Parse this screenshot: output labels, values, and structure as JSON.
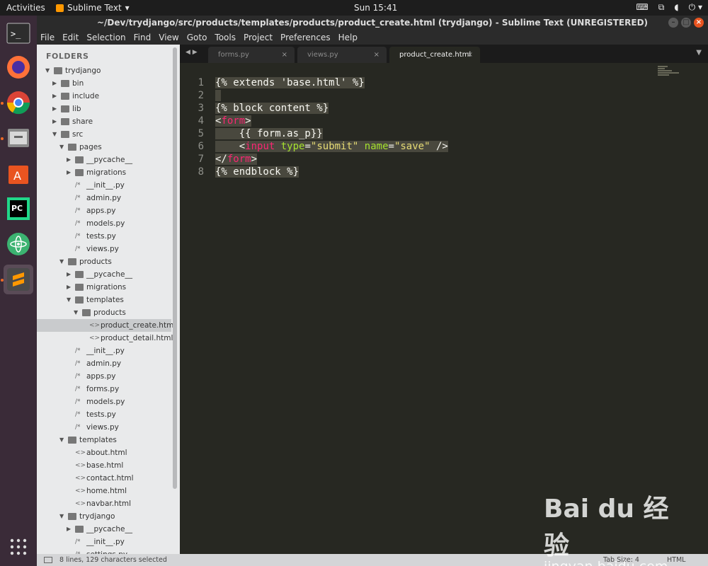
{
  "topbar": {
    "activities": "Activities",
    "app_menu": "Sublime Text",
    "clock": "Sun 15:41"
  },
  "window": {
    "title": "~/Dev/trydjango/src/products/templates/products/product_create.html (trydjango) - Sublime Text (UNREGISTERED)"
  },
  "menu": [
    "File",
    "Edit",
    "Selection",
    "Find",
    "View",
    "Goto",
    "Tools",
    "Project",
    "Preferences",
    "Help"
  ],
  "sidebar": {
    "header": "FOLDERS",
    "items": [
      {
        "label": "trydjango",
        "type": "folder",
        "depth": 0,
        "open": true
      },
      {
        "label": "bin",
        "type": "folder",
        "depth": 1,
        "open": false
      },
      {
        "label": "include",
        "type": "folder",
        "depth": 1,
        "open": false
      },
      {
        "label": "lib",
        "type": "folder",
        "depth": 1,
        "open": false
      },
      {
        "label": "share",
        "type": "folder",
        "depth": 1,
        "open": false
      },
      {
        "label": "src",
        "type": "folder",
        "depth": 1,
        "open": true
      },
      {
        "label": "pages",
        "type": "folder",
        "depth": 2,
        "open": true
      },
      {
        "label": "__pycache__",
        "type": "folder",
        "depth": 3,
        "open": false
      },
      {
        "label": "migrations",
        "type": "folder",
        "depth": 3,
        "open": false
      },
      {
        "label": "__init__.py",
        "type": "py",
        "depth": 3
      },
      {
        "label": "admin.py",
        "type": "py",
        "depth": 3
      },
      {
        "label": "apps.py",
        "type": "py",
        "depth": 3
      },
      {
        "label": "models.py",
        "type": "py",
        "depth": 3
      },
      {
        "label": "tests.py",
        "type": "py",
        "depth": 3
      },
      {
        "label": "views.py",
        "type": "py",
        "depth": 3
      },
      {
        "label": "products",
        "type": "folder",
        "depth": 2,
        "open": true
      },
      {
        "label": "__pycache__",
        "type": "folder",
        "depth": 3,
        "open": false
      },
      {
        "label": "migrations",
        "type": "folder",
        "depth": 3,
        "open": false
      },
      {
        "label": "templates",
        "type": "folder",
        "depth": 3,
        "open": true
      },
      {
        "label": "products",
        "type": "folder",
        "depth": 4,
        "open": true
      },
      {
        "label": "product_create.html",
        "type": "html",
        "depth": 5,
        "selected": true
      },
      {
        "label": "product_detail.html",
        "type": "html",
        "depth": 5
      },
      {
        "label": "__init__.py",
        "type": "py",
        "depth": 3
      },
      {
        "label": "admin.py",
        "type": "py",
        "depth": 3
      },
      {
        "label": "apps.py",
        "type": "py",
        "depth": 3
      },
      {
        "label": "forms.py",
        "type": "py",
        "depth": 3
      },
      {
        "label": "models.py",
        "type": "py",
        "depth": 3
      },
      {
        "label": "tests.py",
        "type": "py",
        "depth": 3
      },
      {
        "label": "views.py",
        "type": "py",
        "depth": 3
      },
      {
        "label": "templates",
        "type": "folder",
        "depth": 2,
        "open": true
      },
      {
        "label": "about.html",
        "type": "html",
        "depth": 3
      },
      {
        "label": "base.html",
        "type": "html",
        "depth": 3
      },
      {
        "label": "contact.html",
        "type": "html",
        "depth": 3
      },
      {
        "label": "home.html",
        "type": "html",
        "depth": 3
      },
      {
        "label": "navbar.html",
        "type": "html",
        "depth": 3
      },
      {
        "label": "trydjango",
        "type": "folder",
        "depth": 2,
        "open": true
      },
      {
        "label": "__pycache__",
        "type": "folder",
        "depth": 3,
        "open": false
      },
      {
        "label": "__init__.py",
        "type": "py",
        "depth": 3
      },
      {
        "label": "settings.py",
        "type": "py",
        "depth": 3
      }
    ]
  },
  "tabs": [
    {
      "label": "forms.py",
      "active": false
    },
    {
      "label": "views.py",
      "active": false
    },
    {
      "label": "product_create.html",
      "active": true
    }
  ],
  "editor": {
    "lines": [
      [
        {
          "t": "{% extends ",
          "c": "tpl"
        },
        {
          "t": "'base.html'",
          "c": "tpl"
        },
        {
          "t": " %}",
          "c": "tpl"
        }
      ],
      [],
      [
        {
          "t": "{% block content %}",
          "c": "tpl"
        }
      ],
      [
        {
          "t": "<",
          "c": "tpl"
        },
        {
          "t": "form",
          "c": "tag"
        },
        {
          "t": ">",
          "c": "tpl"
        }
      ],
      [
        {
          "t": "    {{ form.as_p}}",
          "c": "tpl"
        }
      ],
      [
        {
          "t": "    <",
          "c": "tpl"
        },
        {
          "t": "input",
          "c": "tag"
        },
        {
          "t": " ",
          "c": "tpl"
        },
        {
          "t": "type",
          "c": "attr"
        },
        {
          "t": "=",
          "c": "tpl"
        },
        {
          "t": "\"submit\"",
          "c": "str"
        },
        {
          "t": " ",
          "c": "tpl"
        },
        {
          "t": "name",
          "c": "attr"
        },
        {
          "t": "=",
          "c": "tpl"
        },
        {
          "t": "\"save\"",
          "c": "str"
        },
        {
          "t": " />",
          "c": "tpl"
        }
      ],
      [
        {
          "t": "</",
          "c": "tpl"
        },
        {
          "t": "form",
          "c": "tag"
        },
        {
          "t": ">",
          "c": "tpl"
        }
      ],
      [
        {
          "t": "{% endblock %}",
          "c": "tpl"
        }
      ]
    ]
  },
  "status": {
    "message": "8 lines, 129 characters selected",
    "tab_size": "Tab Size: 4",
    "syntax": "HTML"
  },
  "watermark": {
    "logo": "Bai du 经验",
    "url": "jingyan.baidu.com"
  },
  "colors": {
    "editor_bg": "#272822",
    "tag": "#f92672",
    "attr": "#a6e22e",
    "string": "#e6db74",
    "sidebar_bg": "#e9eaeb",
    "dock_bg": "#3a2b38"
  }
}
